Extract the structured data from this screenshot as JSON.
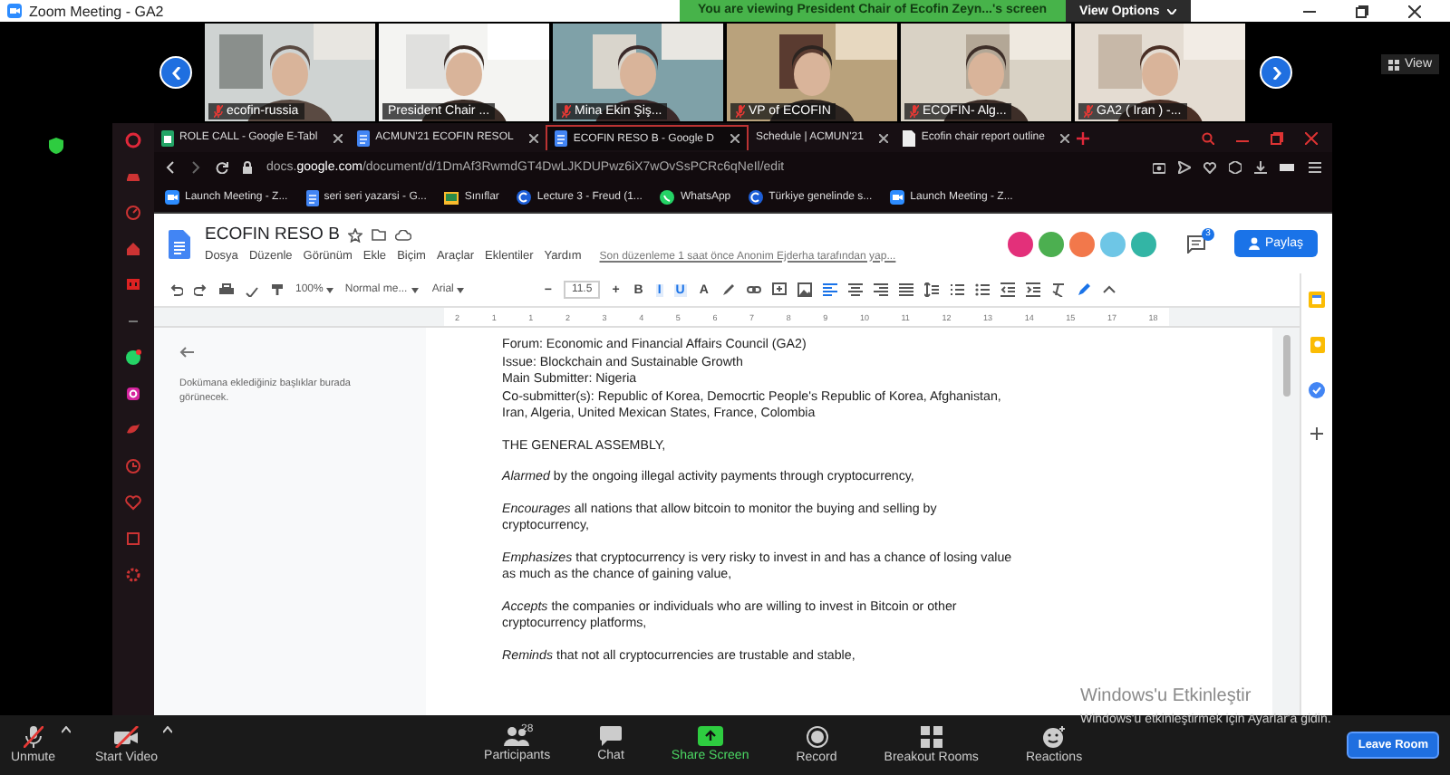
{
  "window": {
    "title": "Zoom Meeting - GA2"
  },
  "banner": {
    "text": "You are viewing President Chair of Ecofin Zeyn...'s screen",
    "view_options": "View Options"
  },
  "gallery": {
    "view_button": "View",
    "tiles": [
      {
        "name": "ecofin-russia",
        "muted": true
      },
      {
        "name": "President Chair ...",
        "muted": false
      },
      {
        "name": "Mina Ekin Şiş...",
        "muted": true
      },
      {
        "name": "VP of ECOFIN",
        "muted": true
      },
      {
        "name": "ECOFIN- Alg...",
        "muted": true
      },
      {
        "name": "GA2 ( Iran ) -...",
        "muted": true
      }
    ]
  },
  "browser": {
    "tabs": [
      {
        "title": "ROLE CALL - Google E-Tabl",
        "kind": "sheets",
        "selected": false
      },
      {
        "title": "ACMUN'21 ECOFIN RESOL",
        "kind": "docs",
        "selected": false
      },
      {
        "title": "ECOFIN RESO B - Google D",
        "kind": "docs",
        "selected": true
      },
      {
        "title": "Schedule | ACMUN'21",
        "kind": "none",
        "selected": false
      },
      {
        "title": "Ecofin chair report outline",
        "kind": "file",
        "selected": false
      }
    ],
    "url": "docs.**google.com**/document/d/1DmAf3RwmdGT4DwLJKDUPwz6iX7wOvSsPCRc6qNeIl/edit",
    "bookmarks": [
      {
        "title": "Launch Meeting - Z...",
        "kind": "zoom"
      },
      {
        "title": "seri seri yazarsi - G...",
        "kind": "docs"
      },
      {
        "title": "Sınıflar",
        "kind": "classroom"
      },
      {
        "title": "Lecture 3 - Freud (1...",
        "kind": "circle"
      },
      {
        "title": "WhatsApp",
        "kind": "whatsapp"
      },
      {
        "title": "Türkiye genelinde s...",
        "kind": "circle"
      },
      {
        "title": "Launch Meeting - Z...",
        "kind": "zoom"
      }
    ]
  },
  "docs": {
    "title": "ECOFIN RESO B",
    "menus": [
      "Dosya",
      "Düzenle",
      "Görünüm",
      "Ekle",
      "Biçim",
      "Araçlar",
      "Eklentiler",
      "Yardım"
    ],
    "last_edit": "Son düzenleme 1 saat önce Anonim Ejderha tarafından yap...",
    "collaborators": [
      {
        "color": "#e3307a"
      },
      {
        "color": "#4caf50"
      },
      {
        "color": "#f2784b"
      },
      {
        "color": "#6ec6e6"
      },
      {
        "color": "#33b5a5"
      }
    ],
    "comment_count": "3",
    "share": "Paylaş",
    "toolbar": {
      "zoom": "100%",
      "style": "Normal me...",
      "font": "Arial",
      "size": "11.5",
      "minus": "−",
      "plus": "+",
      "format": [
        {
          "label": "B",
          "selected": false
        },
        {
          "label": "I",
          "selected": true
        },
        {
          "label": "U",
          "selected": true
        },
        {
          "label": "A",
          "selected": false
        }
      ]
    },
    "ruler": [
      "2",
      "1",
      "1",
      "2",
      "3",
      "4",
      "5",
      "6",
      "7",
      "8",
      "9",
      "10",
      "11",
      "12",
      "13",
      "14",
      "15",
      "17",
      "18"
    ],
    "outline_hint": "Dokümana eklediğiniz başlıklar burada görünecek.",
    "header_lines": [
      "Forum: Economic and Financial Affairs Council (GA2)",
      "Issue: Blockchain and Sustainable Growth",
      "Main Submitter: Nigeria",
      "Co-submitter(s): Republic of Korea, Democrtic People's Republic of Korea, Afghanistan, Iran, Algeria, United Mexican States, France, Colombia"
    ],
    "paragraphs": [
      "THE GENERAL ASSEMBLY,",
      "*Alarmed* by the ongoing illegal activity payments through cryptocurrency,",
      "*Encourages* all nations that allow bitcoin to monitor the buying and selling by cryptocurrency,",
      "*Emphasizes* that cryptocurrency is very risky to invest in and has a chance of losing value as much as the chance of gaining value,",
      "*Accepts* the companies or individuals who are willing to invest in Bitcoin or other cryptocurrency platforms,",
      "*Reminds* that not all cryptocurrencies are trustable and stable,"
    ]
  },
  "controls": {
    "left": [
      {
        "label": "Unmute",
        "kind": "mic-off"
      },
      {
        "label": "Start Video",
        "kind": "video-off"
      }
    ],
    "center": [
      {
        "label": "Participants",
        "kind": "participants",
        "count": "28"
      },
      {
        "label": "Chat",
        "kind": "chat"
      },
      {
        "label": "Share Screen",
        "kind": "share"
      },
      {
        "label": "Record",
        "kind": "record"
      },
      {
        "label": "Breakout Rooms",
        "kind": "breakout"
      },
      {
        "label": "Reactions",
        "kind": "reactions"
      }
    ],
    "leave": "Leave Room"
  },
  "activation": {
    "title": "Windows'u Etkinleştir",
    "hint": "Windows'u etkinleştirmek için Ayarlar'a gidin."
  }
}
